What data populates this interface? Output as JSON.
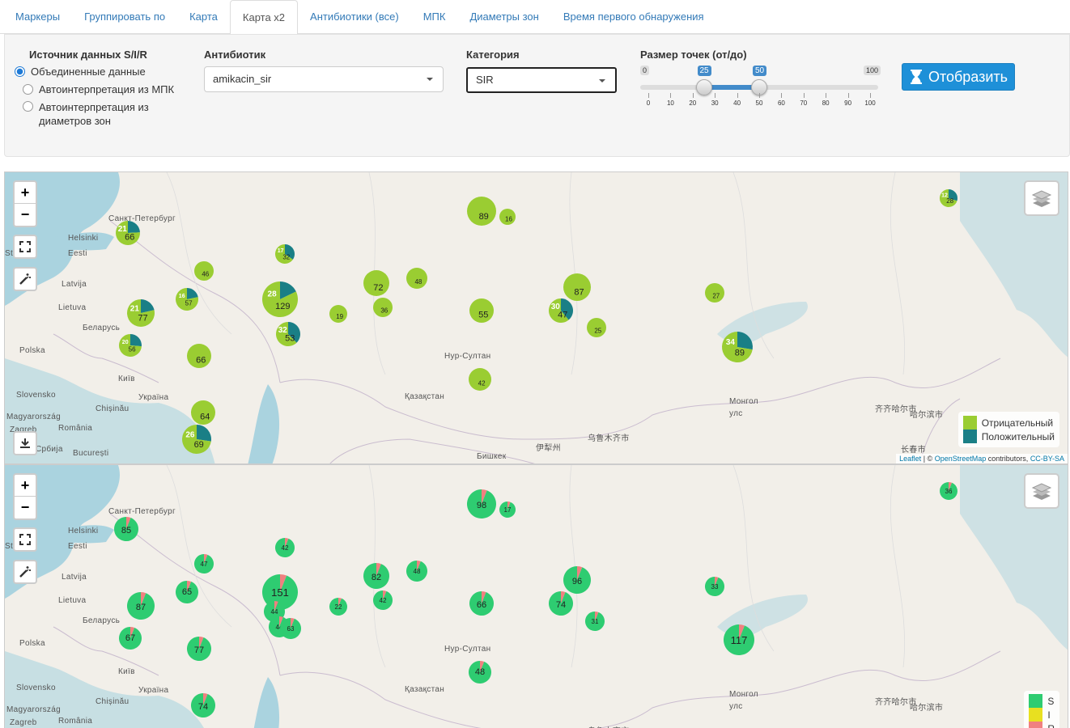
{
  "tabs": [
    {
      "label": "Маркеры"
    },
    {
      "label": "Группировать по"
    },
    {
      "label": "Карта"
    },
    {
      "label": "Карта x2"
    },
    {
      "label": "Антибиотики (все)"
    },
    {
      "label": "МПК"
    },
    {
      "label": "Диаметры зон"
    },
    {
      "label": "Время первого обнаружения"
    }
  ],
  "controls": {
    "source_label": "Источник данных S/I/R",
    "source_options": [
      "Объединенные данные",
      "Автоинтерпретация из МПК",
      "Автоинтерпретация из диаметров зон"
    ],
    "source_selected": 0,
    "antibiotic_label": "Антибиотик",
    "antibiotic_value": "amikacin_sir",
    "category_label": "Категория",
    "category_value": "SIR",
    "size_label": "Размер точек (от/до)",
    "size_min": 0,
    "size_max": 100,
    "size_from": 25,
    "size_to": 50,
    "size_ticks": [
      "0",
      "10",
      "20",
      "30",
      "40",
      "50",
      "60",
      "70",
      "80",
      "90",
      "100"
    ],
    "button_label": "Отобразить"
  },
  "colors": {
    "negative": "#9acd32",
    "positive": "#1a7f86",
    "S": "#2ecc71",
    "I": "#e8e020",
    "R": "#f08080",
    "accent": "#1e90d8"
  },
  "places": [
    {
      "name": "Санкт-Петербург"
    },
    {
      "name": "Helsinki"
    },
    {
      "name": "Eesti"
    },
    {
      "name": "Latvija"
    },
    {
      "name": "Lietuva"
    },
    {
      "name": "Беларусь"
    },
    {
      "name": "Polska"
    },
    {
      "name": "Київ"
    },
    {
      "name": "Україна"
    },
    {
      "name": "Slovensko"
    },
    {
      "name": "Magyarország"
    },
    {
      "name": "Chișinău"
    },
    {
      "name": "România"
    },
    {
      "name": "Zagreb"
    },
    {
      "name": "Србија"
    },
    {
      "name": "București"
    },
    {
      "name": "Нур-Султан"
    },
    {
      "name": "Қазақстан"
    },
    {
      "name": "Монгол"
    },
    {
      "name": "улс"
    },
    {
      "name": "齐齐哈尔市"
    },
    {
      "name": "哈尔滨市"
    },
    {
      "name": "长春市"
    },
    {
      "name": "乌鲁木齐市"
    },
    {
      "name": "伊犁州"
    },
    {
      "name": "Бишкек"
    },
    {
      "name": "Stoc"
    }
  ],
  "map1": {
    "legend": [
      {
        "label": "Отрицательный",
        "color": "#9acd32"
      },
      {
        "label": "Положительный",
        "color": "#1a7f86"
      }
    ],
    "attribution": {
      "leaflet": "Leaflet",
      "sep": "| ©",
      "osm": "OpenStreetMap",
      "contrib": "contributors,",
      "license": "CC-BY-SA"
    },
    "markers": [
      {
        "neg": 66,
        "pos": 21
      },
      {
        "neg": 89,
        "pos": 0
      },
      {
        "neg": 16,
        "pos": 0
      },
      {
        "neg": 28,
        "pos": 12
      },
      {
        "neg": 32,
        "pos": 17
      },
      {
        "neg": 46,
        "pos": 0
      },
      {
        "neg": 57,
        "pos": 16
      },
      {
        "neg": 129,
        "pos": 28
      },
      {
        "neg": 77,
        "pos": 21
      },
      {
        "neg": 72,
        "pos": 0
      },
      {
        "neg": 48,
        "pos": 0
      },
      {
        "neg": 87,
        "pos": 0
      },
      {
        "neg": 19,
        "pos": 0
      },
      {
        "neg": 36,
        "pos": 0
      },
      {
        "neg": 55,
        "pos": 0
      },
      {
        "neg": 47,
        "pos": 30
      },
      {
        "neg": 27,
        "pos": 0
      },
      {
        "neg": 53,
        "pos": 32
      },
      {
        "neg": 25,
        "pos": 0
      },
      {
        "neg": 56,
        "pos": 20
      },
      {
        "neg": 66,
        "pos": 0
      },
      {
        "neg": 89,
        "pos": 34
      },
      {
        "neg": 42,
        "pos": 0
      },
      {
        "neg": 64,
        "pos": 0
      },
      {
        "neg": 69,
        "pos": 26
      },
      {
        "neg": 0,
        "pos": 36
      }
    ]
  },
  "map2": {
    "legend": [
      {
        "label": "S",
        "color": "#2ecc71"
      },
      {
        "label": "I",
        "color": "#e8e020"
      },
      {
        "label": "R",
        "color": "#f08080"
      }
    ],
    "markers": [
      {
        "value": 85
      },
      {
        "value": 98
      },
      {
        "value": 17
      },
      {
        "value": 36
      },
      {
        "value": 42
      },
      {
        "value": 47
      },
      {
        "value": 65
      },
      {
        "value": 151
      },
      {
        "value": 87
      },
      {
        "value": 82
      },
      {
        "value": 48
      },
      {
        "value": 96
      },
      {
        "value": 22
      },
      {
        "value": 42
      },
      {
        "value": 66
      },
      {
        "value": 74
      },
      {
        "value": 33
      },
      {
        "value": 44
      },
      {
        "value": 44
      },
      {
        "value": 63
      },
      {
        "value": 31
      },
      {
        "value": 67
      },
      {
        "value": 77
      },
      {
        "value": 117
      },
      {
        "value": 48
      },
      {
        "value": 74
      }
    ]
  }
}
